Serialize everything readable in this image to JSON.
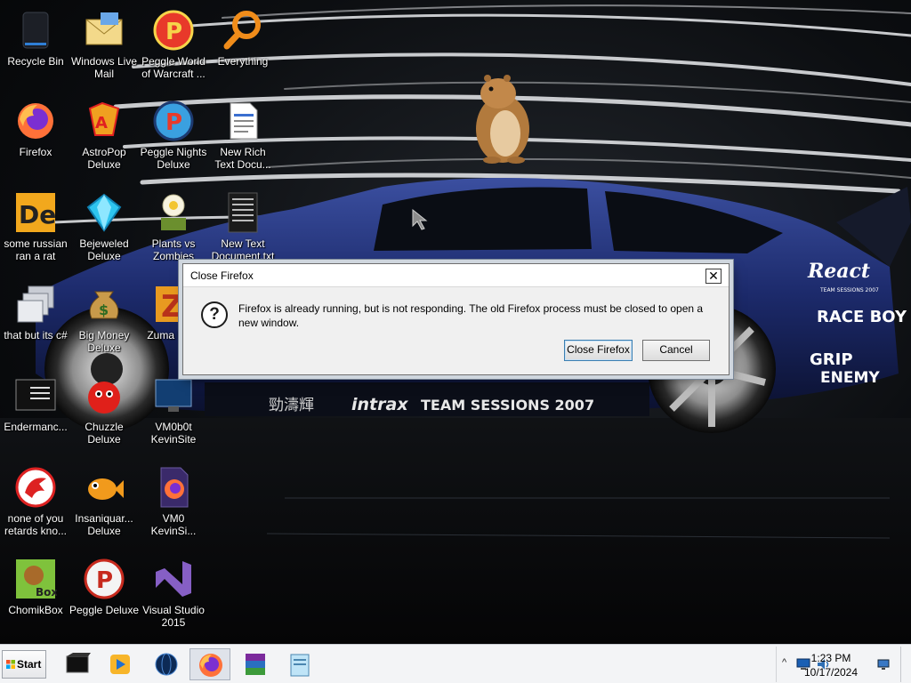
{
  "desktop": {
    "icons": [
      {
        "name": "recycle-bin-icon",
        "label": "Recycle Bin"
      },
      {
        "name": "windows-live-mail-icon",
        "label": "Windows Live\nMail"
      },
      {
        "name": "peggle-world-of-warcraft-icon",
        "label": "Peggle World\nof Warcraft ..."
      },
      {
        "name": "everything-search-icon",
        "label": "Everything"
      },
      {
        "name": "firefox-icon",
        "label": "Firefox"
      },
      {
        "name": "astropop-deluxe-icon",
        "label": "AstroPop\nDeluxe"
      },
      {
        "name": "peggle-nights-deluxe-icon",
        "label": "Peggle Nights\nDeluxe"
      },
      {
        "name": "rich-text-document-icon",
        "label": "New Rich\nText Docu..."
      },
      {
        "name": "de-app-icon",
        "label": "some russian\nran a rat"
      },
      {
        "name": "bejeweled-deluxe-icon",
        "label": "Bejeweled\nDeluxe"
      },
      {
        "name": "plants-vs-zombies-icon",
        "label": "Plants vs\nZombies"
      },
      {
        "name": "text-document-icon",
        "label": "New Text\nDocument.txt"
      },
      {
        "name": "stacked-windows-icon",
        "label": "that but its c#"
      },
      {
        "name": "big-money-deluxe-icon",
        "label": "Big Money\nDeluxe"
      },
      {
        "name": "zuma-deluxe-icon",
        "label": "Zuma De..."
      },
      {
        "name": "terminal-icon",
        "label": "Endermanc..."
      },
      {
        "name": "chuzzle-deluxe-icon",
        "label": "Chuzzle\nDeluxe"
      },
      {
        "name": "vm-monitor-icon",
        "label": "VM0b0t\nKevinSite"
      },
      {
        "name": "red-dragon-icon",
        "label": "none of you\nretards kno..."
      },
      {
        "name": "insaniquarium-deluxe-icon",
        "label": "Insaniquar...\nDeluxe"
      },
      {
        "name": "firefox-file-icon",
        "label": "VM0\nKevinSi..."
      },
      {
        "name": "chomikbox-icon",
        "label": "ChomikBox"
      },
      {
        "name": "peggle-deluxe-icon",
        "label": "Peggle Deluxe"
      },
      {
        "name": "visual-studio-icon",
        "label": "Visual Studio\n2015"
      }
    ]
  },
  "wallpaper": {
    "car_text": "TEAM SESSIONS 2007",
    "brand_text": "intrax",
    "logo_react": "React",
    "logo_react_sub": "TEAM SESSIONS 2007",
    "logo_raceboy": "RACE BOY",
    "logo_grip": "GRIP",
    "logo_enemy": "ENEMY",
    "kanji": "勁濤輝"
  },
  "dialog": {
    "title": "Close Firefox",
    "close_glyph": "✕",
    "question_glyph": "?",
    "message": "Firefox is already running, but is not responding. The old Firefox process must be closed to open a new window.",
    "buttons": {
      "close_firefox": "Close Firefox",
      "cancel": "Cancel"
    }
  },
  "taskbar": {
    "start_label": "Start",
    "apps": [
      {
        "name": "taskbar-terminal-icon"
      },
      {
        "name": "taskbar-media-player-icon"
      },
      {
        "name": "taskbar-globe-icon"
      },
      {
        "name": "taskbar-firefox-icon",
        "active": true
      },
      {
        "name": "taskbar-winrar-icon"
      },
      {
        "name": "taskbar-notepad-icon"
      }
    ],
    "tray": {
      "chevron": "^",
      "time": "1:23 PM",
      "date": "10/17/2024"
    }
  },
  "colors": {
    "dialog_bg": "#f0f0f0",
    "taskbar_bg": "#f3f4f6",
    "car_blue": "#1c2a6b",
    "firefox_orange": "#ff7139"
  }
}
